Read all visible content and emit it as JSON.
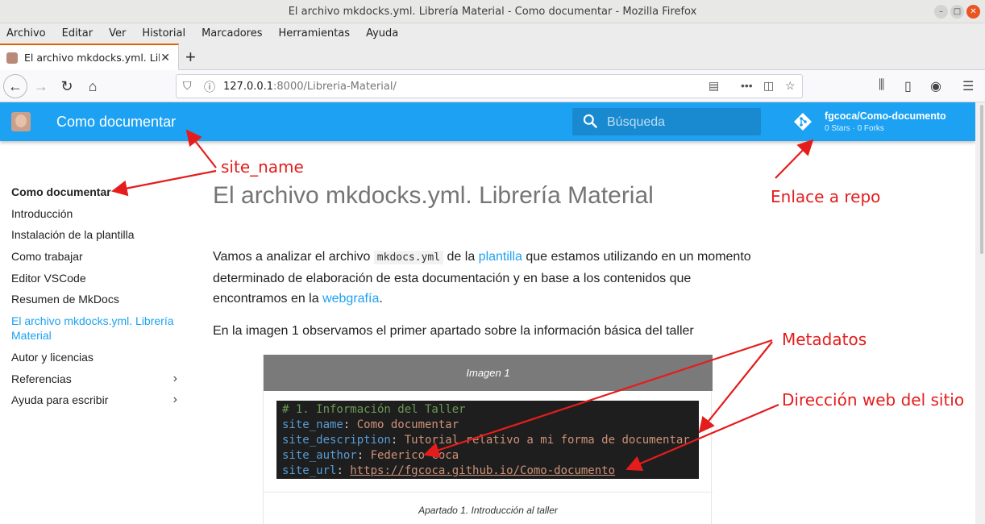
{
  "window": {
    "title": "El archivo mkdocks.yml. Librería Material - Como documentar - Mozilla Firefox"
  },
  "menubar": [
    "Archivo",
    "Editar",
    "Ver",
    "Historial",
    "Marcadores",
    "Herramientas",
    "Ayuda"
  ],
  "tab": {
    "title": "El archivo mkdocks.yml. Lib"
  },
  "url": {
    "host": "127.0.0.1",
    "rest": ":8000/Libreria-Material/"
  },
  "header": {
    "site_name": "Como documentar",
    "search_placeholder": "Búsqueda",
    "repo_name": "fgcoca/Como-documento",
    "repo_stats": "0 Stars · 0 Forks"
  },
  "sidebar": {
    "items": [
      {
        "label": "Como documentar"
      },
      {
        "label": "Introducción"
      },
      {
        "label": "Instalación de la plantilla"
      },
      {
        "label": "Como trabajar"
      },
      {
        "label": "Editor VSCode"
      },
      {
        "label": "Resumen de MkDocs"
      },
      {
        "label": "El archivo mkdocks.yml. Librería Material"
      },
      {
        "label": "Autor y licencias"
      },
      {
        "label": "Referencias"
      },
      {
        "label": "Ayuda para escribir"
      }
    ]
  },
  "content": {
    "title": "El archivo mkdocks.yml. Librería Material",
    "p1_a": "Vamos a analizar el archivo ",
    "p1_code": "mkdocs.yml",
    "p1_b": " de la ",
    "p1_link1": "plantilla",
    "p1_c": " que estamos utilizando en un momento",
    "p1_d": "determinado de elaboración de esta documentación y en base a los contenidos que",
    "p1_e": "encontramos en la ",
    "p1_link2": "webgrafía",
    "p1_f": ".",
    "p2": "En la imagen 1 observamos el primer apartado sobre la información básica del taller",
    "figure": {
      "heading": "Imagen 1",
      "code": {
        "comment": "# 1. Información del Taller",
        "k1": "site_name",
        "v1": "Como documentar",
        "k2": "site_description",
        "v2": "Tutorial relativo a mi forma de documentar",
        "k3": "site_author",
        "v3": "Federico Coca",
        "k4": "site_url",
        "v4": "https://fgcoca.github.io/Como-documento"
      },
      "caption": "Apartado 1. Introducción al taller"
    }
  },
  "annotations": {
    "site_name": "site_name",
    "repo": "Enlace a repo",
    "metadatos": "Metadatos",
    "direccion": "Dirección web del sitio"
  },
  "colors": {
    "header": "#1da1f2",
    "accent": "#1da1f2",
    "annotation": "#e51c1c"
  }
}
